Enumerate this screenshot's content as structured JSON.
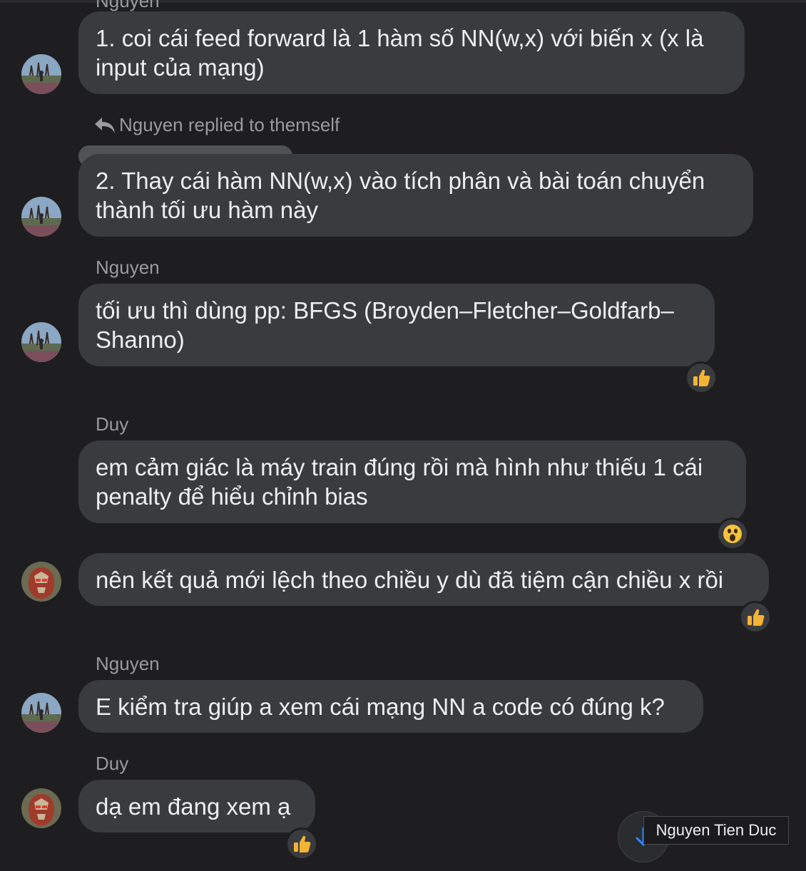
{
  "conversation": {
    "top_cut_sender": "Nguyen",
    "reply_indicator": "Nguyen replied to themself",
    "messages": [
      {
        "sender": "",
        "lines": [
          "1. coi cái feed forward là 1 hàm số NN(w,x) với biến x (x là",
          "input của mạng)"
        ],
        "avatar": "nguyen"
      },
      {
        "sender": "",
        "lines": [
          "2. Thay cái hàm NN(w,x) vào tích phân và bài toán chuyển",
          "thành tối ưu hàm này"
        ],
        "avatar": "nguyen"
      },
      {
        "sender": "Nguyen",
        "lines": [
          "tối ưu thì dùng pp: BFGS (Broyden–Fletcher–Goldfarb–",
          "Shanno)"
        ],
        "avatar": "nguyen",
        "reaction": "thumbs-up"
      },
      {
        "sender": "Duy",
        "lines": [
          "em cảm giác là máy train đúng rồi mà hình như thiếu 1 cái",
          "penalty để hiểu chỉnh bias"
        ],
        "avatar": "",
        "reaction": "wow"
      },
      {
        "sender": "",
        "lines": [
          "nên kết quả mới lệch theo chiều y dù đã tiệm cận chiều x rồi"
        ],
        "avatar": "duy",
        "reaction": "thumbs-up"
      },
      {
        "sender": "Nguyen",
        "lines": [
          "E kiểm tra giúp a xem cái mạng NN a code có đúng k?"
        ],
        "avatar": "nguyen"
      },
      {
        "sender": "Duy",
        "lines": [
          "dạ em đang xem ạ"
        ],
        "avatar": "duy",
        "reaction": "thumbs-up"
      }
    ]
  },
  "scroll_tooltip": "Nguyen Tien Duc",
  "icons": {
    "reply": "reply-arrow-icon",
    "like": "thumbs-up-icon",
    "wow": "wow-face-icon",
    "scroll": "arrow-down-icon"
  },
  "colors": {
    "background": "#1e1e20",
    "bubble": "#3a3b3e",
    "text": "#eceef0",
    "muted": "#9a9b9e",
    "like": "#f5b335",
    "scroll_arrow": "#2d88ff"
  }
}
